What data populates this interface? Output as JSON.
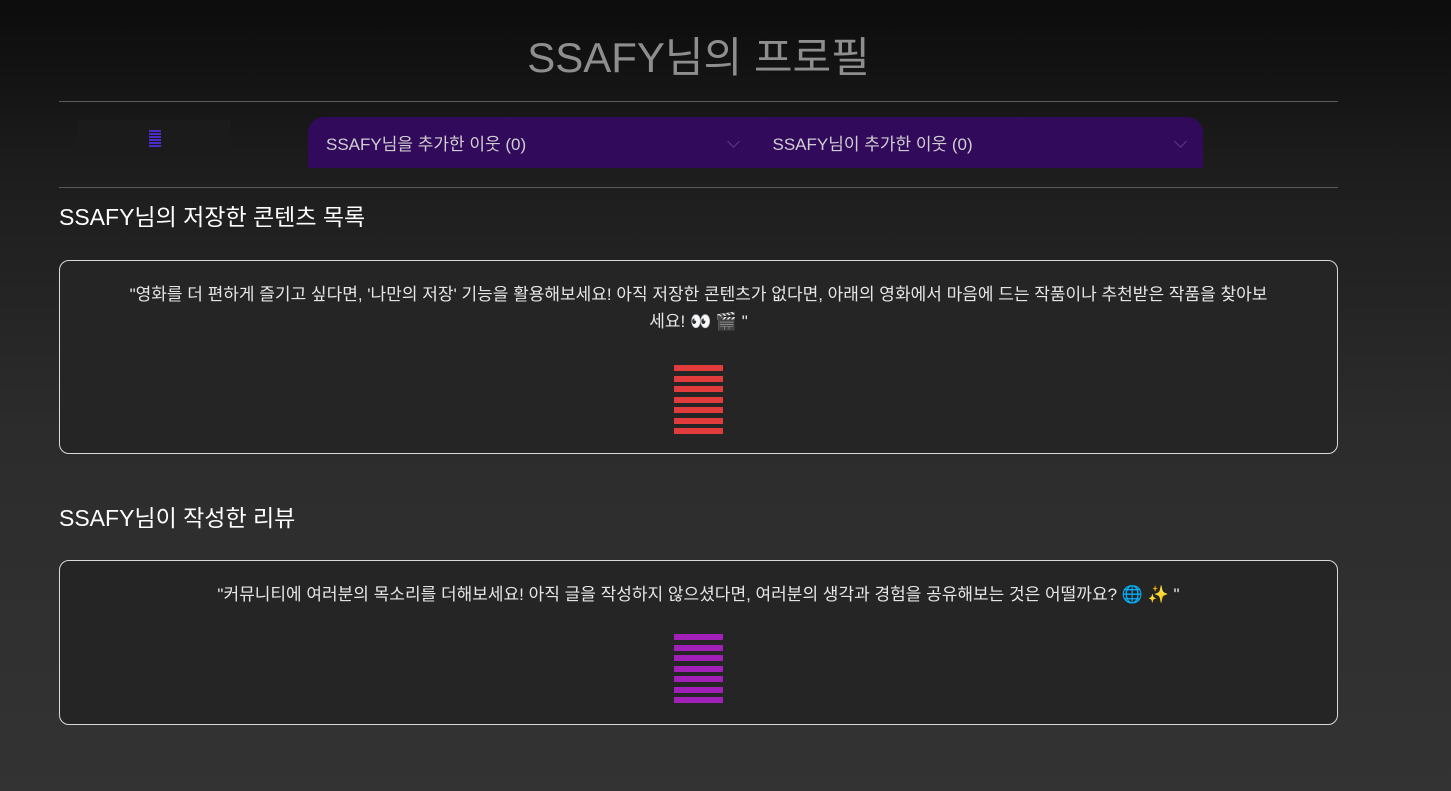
{
  "header": {
    "title": "SSAFY님의 프로필"
  },
  "menu": {
    "icon": "hamburger-icon"
  },
  "neighbors": {
    "followers_label": "SSAFY님을 추가한 이웃 (0)",
    "following_label": "SSAFY님이 추가한 이웃 (0)"
  },
  "saved": {
    "title": "SSAFY님의 저장한 콘텐츠 목록",
    "empty_message": "\"영화를 더 편하게 즐기고 싶다면, '나만의 저장' 기능을 활용해보세요! 아직 저장한 콘텐츠가 없다면, 아래의 영화에서 마음에 드는 작품이나 추천받은 작품을 찾아보세요! 👀 🎬 \"",
    "icon": "stripes-icon",
    "accent_color": "#e23b3b"
  },
  "reviews": {
    "title": "SSAFY님이 작성한 리뷰",
    "empty_message": "\"커뮤니티에 여러분의 목소리를 더해보세요! 아직 글을 작성하지 않으셨다면, 여러분의 생각과 경험을 공유해보는 것은 어떨까요? 🌐 ✨ \"",
    "icon": "stripes-icon",
    "accent_color": "#a020b8"
  },
  "colors": {
    "neighbors_bar": "#320a5c",
    "menu_icon": "#4b2cc9"
  }
}
